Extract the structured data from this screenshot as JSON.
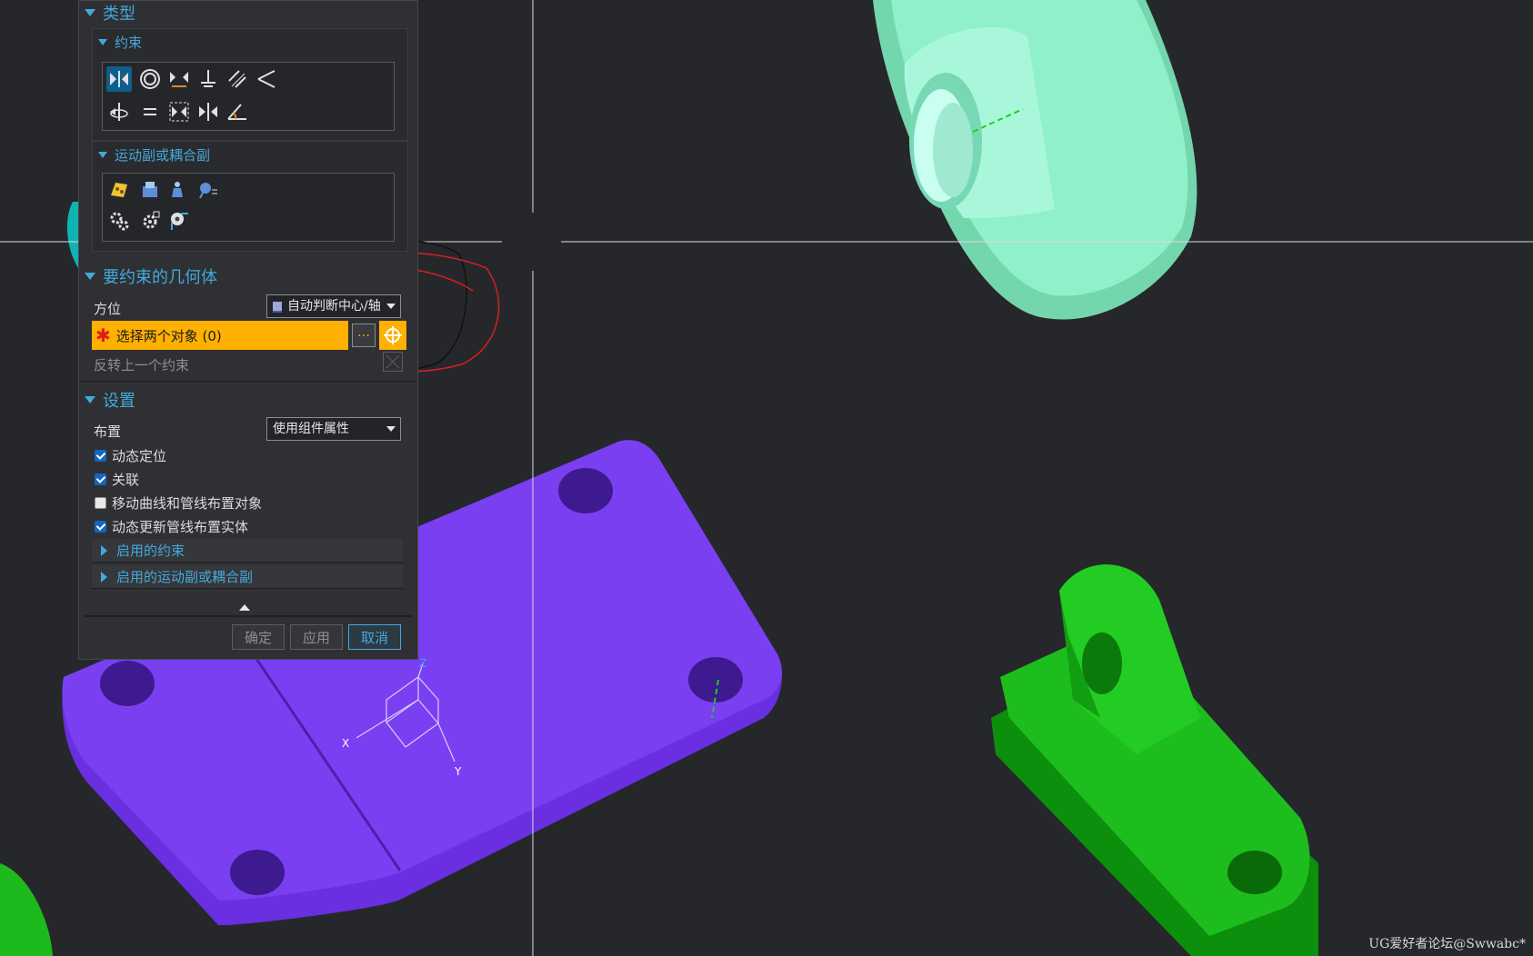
{
  "dialog": {
    "group_type": "类型",
    "sub_constraints": "约束",
    "sub_motion": "运动副或耦合副",
    "constraint_icons": [
      "touch-align-icon",
      "concentric-icon",
      "distance-icon",
      "fix-icon",
      "parallel-icon",
      "perpendicular-icon",
      "align-lock-icon",
      "equal-icon",
      "fit-icon",
      "bond-icon",
      "angle-icon"
    ],
    "motion_icons": [
      "joint-wizard-icon",
      "motion-a-icon",
      "motion-b-icon",
      "motion-c-icon",
      "gear-icon",
      "gear-settings-icon",
      "pin-icon"
    ],
    "group_geometry": "要约束的几何体",
    "orientation_label": "方位",
    "orientation_value": "自动判断中心/轴",
    "select_objects": "选择两个对象 (0)",
    "reverse_constraint": "反转上一个约束",
    "group_settings": "设置",
    "layout_label": "布置",
    "layout_value": "使用组件属性",
    "checkboxes": [
      {
        "label": "动态定位",
        "checked": true
      },
      {
        "label": "关联",
        "checked": true
      },
      {
        "label": "移动曲线和管线布置对象",
        "checked": false
      },
      {
        "label": "动态更新管线布置实体",
        "checked": true
      }
    ],
    "enabled_constraints": "启用的约束",
    "enabled_motion": "启用的运动副或耦合副",
    "ok": "确定",
    "apply": "应用",
    "cancel": "取消"
  },
  "triad": {
    "x": "X",
    "y": "Y",
    "z": "Z"
  },
  "watermark": "UG爱好者论坛@Swwabc*",
  "colors": {
    "background": "#26272b",
    "plate": "#7b3ff2",
    "bearing": "#86e6bf",
    "bracket": "#1ebd1e",
    "accent": "#43a8dc",
    "selection": "#ffb000"
  }
}
